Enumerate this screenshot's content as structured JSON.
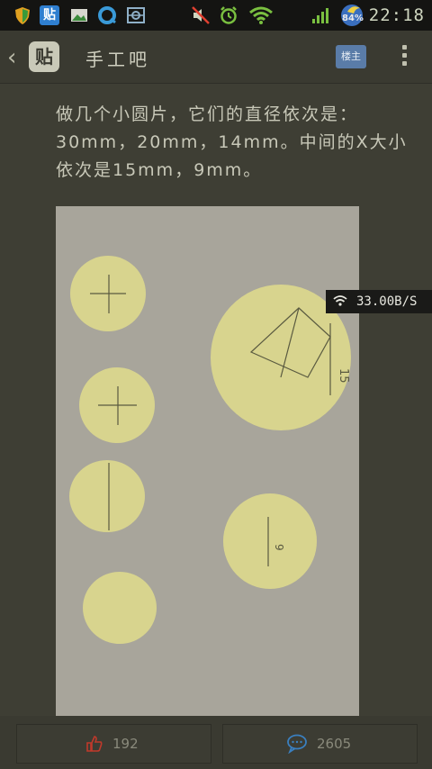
{
  "status_bar": {
    "time": "22:18",
    "battery_percent": "84%",
    "icons": [
      "shield-icon",
      "tieba-app-icon",
      "gallery-icon",
      "qq-browser-icon",
      "scanner-icon",
      "mute-icon",
      "alarm-icon",
      "wifi-icon",
      "signal-icon",
      "battery-icon"
    ]
  },
  "header": {
    "back_label": "‹",
    "logo_text": "贴",
    "forum_name": "手工吧",
    "louzhu_label": "楼主"
  },
  "post": {
    "text": "做几个小圆片，它们的直径依次是：30mm，20mm，14mm。中间的X大小依次是15mm，9mm。"
  },
  "photo": {
    "annotations": [
      "15",
      "9"
    ]
  },
  "speed_overlay": {
    "value": "33.00B/S"
  },
  "bottom_bar": {
    "like_count": "192",
    "comment_count": "2605"
  },
  "colors": {
    "status_bg": "#141412",
    "page_bg": "#3e3e34",
    "accent_blue": "#5a7ca8",
    "like_red": "#c0392b",
    "comment_blue": "#3a7fbf"
  }
}
